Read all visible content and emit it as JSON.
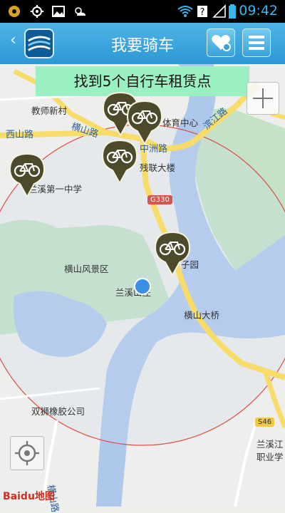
{
  "status_bar": {
    "time": "09:42"
  },
  "header": {
    "title": "我要骑车",
    "back_glyph": "‹"
  },
  "banner": {
    "text": "找到5个自行车租赁点"
  },
  "map": {
    "places": [
      {
        "key": "jiaoshi",
        "text": "教师新村"
      },
      {
        "key": "xishan",
        "text": "西山路"
      },
      {
        "key": "tiyu",
        "text": "体育中心"
      },
      {
        "key": "canlian",
        "text": "残联大楼"
      },
      {
        "key": "lanxi1",
        "text": "兰溪第一中学"
      },
      {
        "key": "hengshan_fj",
        "text": "横山风景区"
      },
      {
        "key": "lanhe",
        "text": "兰溪山庄"
      },
      {
        "key": "ziyuan",
        "text": "子园"
      },
      {
        "key": "bridge",
        "text": "横山大桥"
      },
      {
        "key": "shuangshi",
        "text": "双狮橡胶公司"
      },
      {
        "key": "vocational1",
        "text": "兰溪江"
      },
      {
        "key": "vocational2",
        "text": "职业学"
      }
    ],
    "roads": [
      {
        "key": "hengshan",
        "text": "横山路"
      },
      {
        "key": "zhongzhou",
        "text": "中洲路"
      },
      {
        "key": "binjiang",
        "text": "滨江路"
      },
      {
        "key": "hengshan_v",
        "text": "横山路"
      }
    ],
    "shields": {
      "g330": "G330",
      "s46": "S46"
    },
    "bike_stations": 5,
    "attribution": "Baidu地图"
  },
  "colors": {
    "header": "#3aa2da",
    "banner": "#9bf0c1",
    "pin": "#4d4a2c",
    "radius": "#e04a44",
    "water": "#aec8ec",
    "green": "#c4e3c6",
    "road": "#f7dc6a"
  }
}
